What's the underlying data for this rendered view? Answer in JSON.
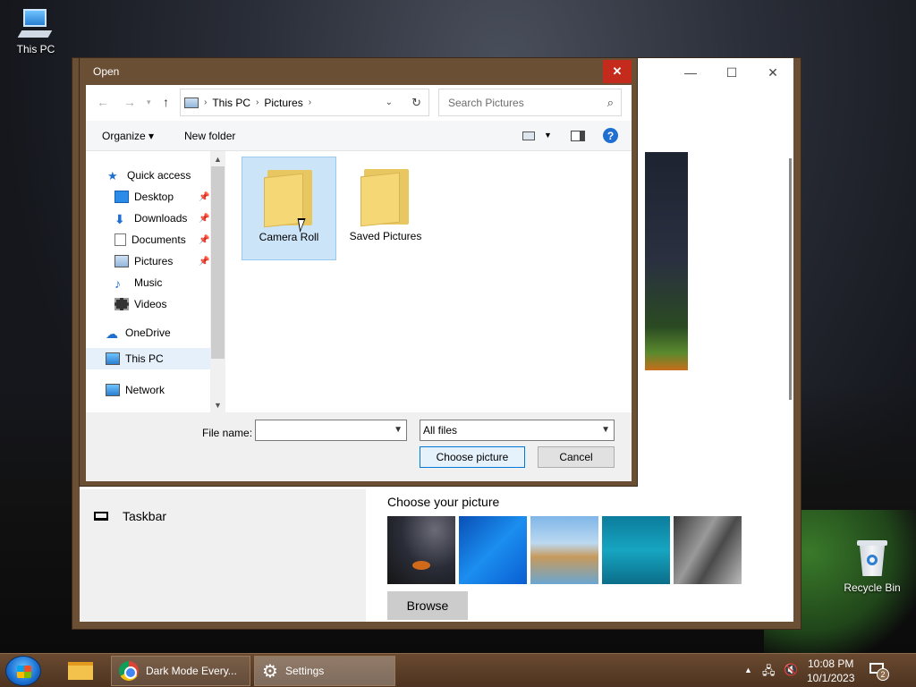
{
  "desktop": {
    "icons": [
      {
        "label": "This PC",
        "icon": "this-pc-icon"
      },
      {
        "label": "Recycle Bin",
        "icon": "recycle-bin-icon"
      }
    ]
  },
  "settings": {
    "left_item": "Taskbar",
    "choose_title": "Choose your picture",
    "browse_label": "Browse",
    "window_controls": {
      "minimize": "—",
      "maximize": "☐",
      "close": "✕"
    }
  },
  "open_dialog": {
    "title": "Open",
    "close_glyph": "✕",
    "breadcrumb": [
      "This PC",
      "Pictures"
    ],
    "search_placeholder": "Search Pictures",
    "toolbar": {
      "organize": "Organize ▾",
      "new_folder": "New folder",
      "help": "?"
    },
    "nav": {
      "quick_access": "Quick access",
      "desktop": "Desktop",
      "downloads": "Downloads",
      "documents": "Documents",
      "pictures": "Pictures",
      "music": "Music",
      "videos": "Videos",
      "onedrive": "OneDrive",
      "this_pc": "This PC",
      "network": "Network"
    },
    "folders": [
      {
        "name": "Camera Roll",
        "selected": true
      },
      {
        "name": "Saved Pictures",
        "selected": false
      }
    ],
    "file_name_label": "File name:",
    "file_name_value": "",
    "file_type_value": "All files",
    "choose_button": "Choose picture",
    "cancel_button": "Cancel"
  },
  "taskbar": {
    "chrome_label": "Dark Mode Every...",
    "settings_label": "Settings",
    "time": "10:08 PM",
    "date": "10/1/2023",
    "notification_count": "2"
  },
  "colors": {
    "accent": "#0078d7",
    "window_frame": "#6b4f35",
    "close_red": "#c42b1c",
    "selection": "#cce4f7"
  }
}
